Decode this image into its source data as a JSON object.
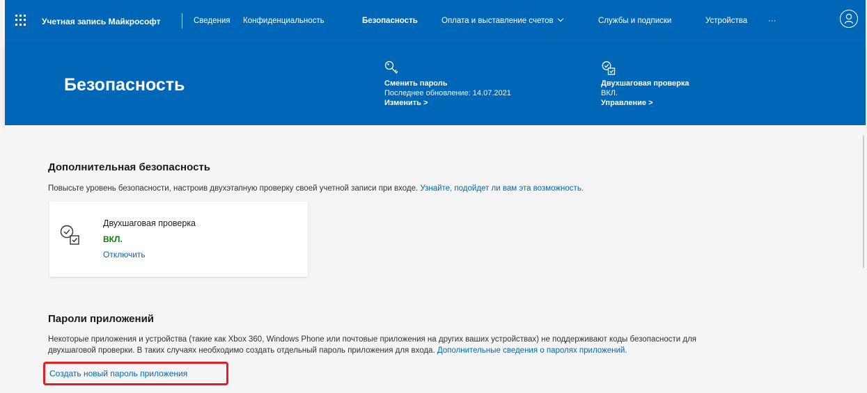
{
  "topnav": {
    "brand": "Учетная запись Майкрософт",
    "items": [
      {
        "label": "Сведения"
      },
      {
        "label": "Конфиденциальность"
      },
      {
        "label": "Безопасность",
        "active": true
      },
      {
        "label": "Оплата и выставление счетов"
      },
      {
        "label": "Службы и подписки"
      },
      {
        "label": "Устройства"
      },
      {
        "label": "···"
      }
    ],
    "icons": {
      "app_launcher": "waffle-icon",
      "avatar": "person-icon",
      "chevron": "chevron-down-icon"
    }
  },
  "hero": {
    "title": "Безопасность",
    "password": {
      "icon": "key-icon",
      "title": "Сменить пароль",
      "subtitle": "Последнее обновление: 14.07.2021",
      "link": "Изменить >"
    },
    "two_step": {
      "icon": "verification-icon",
      "title": "Двухшаговая проверка",
      "subtitle": "ВКЛ.",
      "link": "Управление >"
    }
  },
  "additional_security": {
    "title": "Дополнительная безопасность",
    "text": "Повысьте уровень безопасности, настроив двухэтапную проверку своей учетной записи при входе.",
    "link": "Узнайте, подойдет ли вам эта возможность.",
    "card": {
      "icon": "verification-icon",
      "title": "Двухшаговая проверка",
      "status": "ВКЛ.",
      "link": "Отключить"
    }
  },
  "app_passwords": {
    "title": "Пароли приложений",
    "text_line1": "Некоторые приложения и устройства (такие как Xbox 360, Windows Phone или почтовые приложения на других ваших устройствах) не поддерживают коды безопасности для",
    "text_line2": "двухшаговой проверки. В таких случаях необходимо создать отдельный пароль приложения для входа.",
    "more_link": "Дополнительные сведения о паролях приложений.",
    "create_link": "Создать новый пароль приложения"
  },
  "colors": {
    "brand_blue": "#0067b8",
    "link": "#0067b8",
    "success": "#107c10",
    "highlight": "#e02020"
  }
}
